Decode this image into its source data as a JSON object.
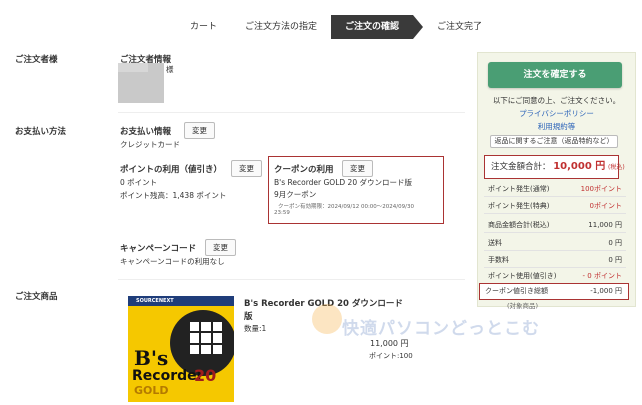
{
  "steps": [
    "カート",
    "ご注文方法の指定",
    "ご注文の確認",
    "ご注文完了"
  ],
  "orderer": {
    "section_label": "ご注文者様",
    "info_title": "ご注文者情報",
    "name_suffix": "様"
  },
  "payment": {
    "section_label": "お支払い方法",
    "info_title": "お支払い情報",
    "method": "クレジットカード",
    "change_label": "変更"
  },
  "points": {
    "title": "ポイントの利用（値引き）",
    "used": "0 ポイント",
    "balance": "ポイント残高：1,438 ポイント",
    "change_label": "変更"
  },
  "coupon": {
    "title": "クーポンの利用",
    "change_label": "変更",
    "name_line1": "B's Recorder GOLD 20 ダウンロード版",
    "name_line2": "9月クーポン",
    "validity_line1": "クーポン有効期限：2024/09/12 00:00～2024/09/30",
    "validity_line2": "23:59"
  },
  "campaign": {
    "title": "キャンペーンコード",
    "change_label": "変更",
    "status": "キャンペーンコードの利用なし"
  },
  "product_section": {
    "section_label": "ご注文商品",
    "name_line1": "B's Recorder GOLD 20 ダウンロード",
    "name_line2": "版",
    "quantity": "数量:1",
    "price": "11,000 円",
    "points": "ポイント:100",
    "image_text": {
      "brand": "SOURCENEXT",
      "logo1": "B's",
      "logo2": "Recorder",
      "logo3": "20",
      "logo4": "GOLD"
    }
  },
  "watermark": "快適パソコンどっとこむ",
  "summary": {
    "confirm_button": "注文を確定する",
    "agree_text": "以下にご同意の上、ご注文ください。",
    "privacy_link": "プライバシーポリシー",
    "terms_link": "利用規約等",
    "return_button": "返品に関するご注意（返品特約など）",
    "total_label": "注文金額合計：",
    "total_value": "10,000 円",
    "total_tax": "(税込)",
    "rows": [
      {
        "label": "ポイント発生(通常)",
        "value": "100",
        "unit": "ポイント",
        "red": true
      },
      {
        "label": "ポイント発生(特典)",
        "value": "0",
        "unit": "ポイント",
        "red": true
      },
      {
        "label": "商品金額合計(税込)",
        "value": "11,000 円",
        "unit": "",
        "red": false
      },
      {
        "label": "送料",
        "value": "0 円",
        "unit": "",
        "red": false
      },
      {
        "label": "手数料",
        "value": "0 円",
        "unit": "",
        "red": false
      },
      {
        "label": "ポイント使用(値引き)",
        "value": "- 0",
        "unit": " ポイント",
        "red": true
      }
    ],
    "coupon_label": "クーポン値引き総額",
    "coupon_value": "-1,000 円",
    "coupon_target": "(対象商品)"
  }
}
